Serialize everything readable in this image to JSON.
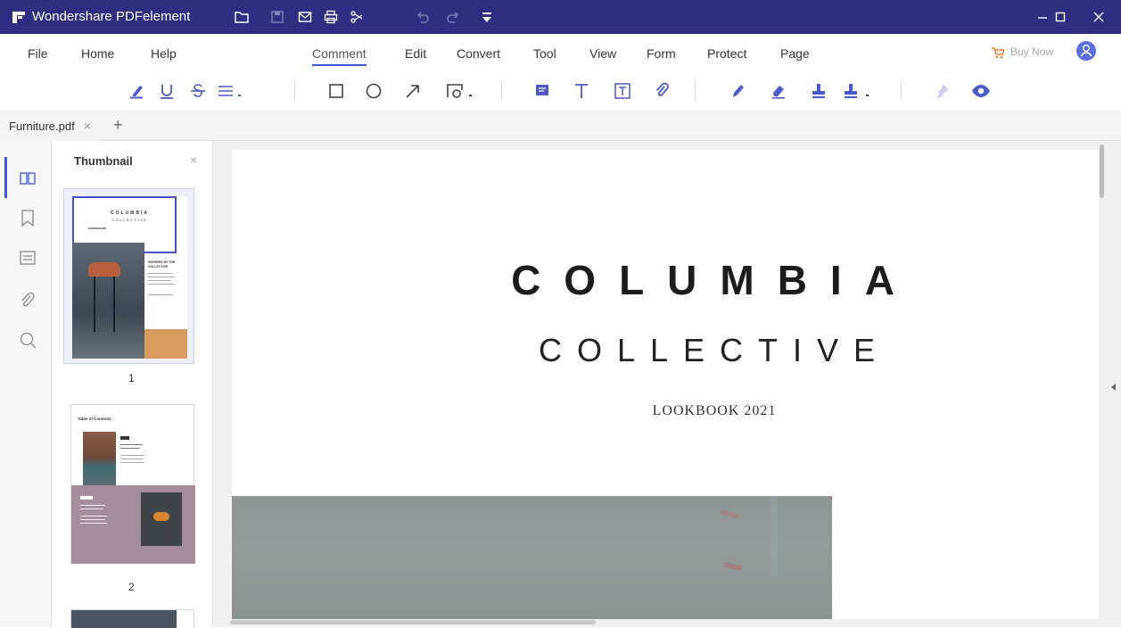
{
  "app": {
    "title": "Wondershare PDFelement",
    "theme_color": "#2e2f82",
    "accent_color": "#3c57d6"
  },
  "titlebar_icons": [
    "folder-icon",
    "save-icon",
    "mail-icon",
    "print-icon",
    "share-icon",
    "undo-icon",
    "redo-icon",
    "quick-access-icon"
  ],
  "menu": {
    "items": [
      {
        "label": "File",
        "name": "menu-file"
      },
      {
        "label": "Home",
        "name": "menu-home"
      },
      {
        "label": "Help",
        "name": "menu-help"
      },
      {
        "label": "Comment",
        "name": "menu-comment",
        "active": true
      },
      {
        "label": "Edit",
        "name": "menu-edit"
      },
      {
        "label": "Convert",
        "name": "menu-convert"
      },
      {
        "label": "Tool",
        "name": "menu-tool"
      },
      {
        "label": "View",
        "name": "menu-view"
      },
      {
        "label": "Form",
        "name": "menu-form"
      },
      {
        "label": "Protect",
        "name": "menu-protect"
      },
      {
        "label": "Page",
        "name": "menu-page"
      }
    ],
    "buy_now": "Buy Now"
  },
  "toolbar_icons": [
    "highlight-icon",
    "underline-icon",
    "strikethrough-icon",
    "text-markup-dropdown-icon",
    "rectangle-icon",
    "oval-icon",
    "arrow-icon",
    "area-shape-dropdown-icon",
    "sticky-note-icon",
    "text-icon",
    "text-box-icon",
    "attachment-icon",
    "pencil-icon",
    "eraser-icon",
    "stamp-icon",
    "stamp-dropdown-icon",
    "pin-icon",
    "show-hide-comments-icon"
  ],
  "tabs": [
    {
      "label": "Furniture.pdf",
      "close": "×"
    }
  ],
  "new_tab": "+",
  "sidebar_icons": [
    "thumbnail-icon",
    "bookmark-icon",
    "comment-list-icon",
    "attachment-icon",
    "search-icon"
  ],
  "thumbnail_panel": {
    "title": "Thumbnail",
    "close": "×",
    "pages": [
      {
        "number": "1",
        "title_top": "COLUMBIA",
        "title_sub": "COLLECTIVE",
        "caption": "INSPIRED BY THE COLLECTIVE"
      },
      {
        "number": "2",
        "heading": "Table of Contents"
      }
    ]
  },
  "document": {
    "title": "COLUMBIA",
    "subtitle": "COLLECTIVE",
    "tagline": "LOOKBOOK 2021"
  }
}
